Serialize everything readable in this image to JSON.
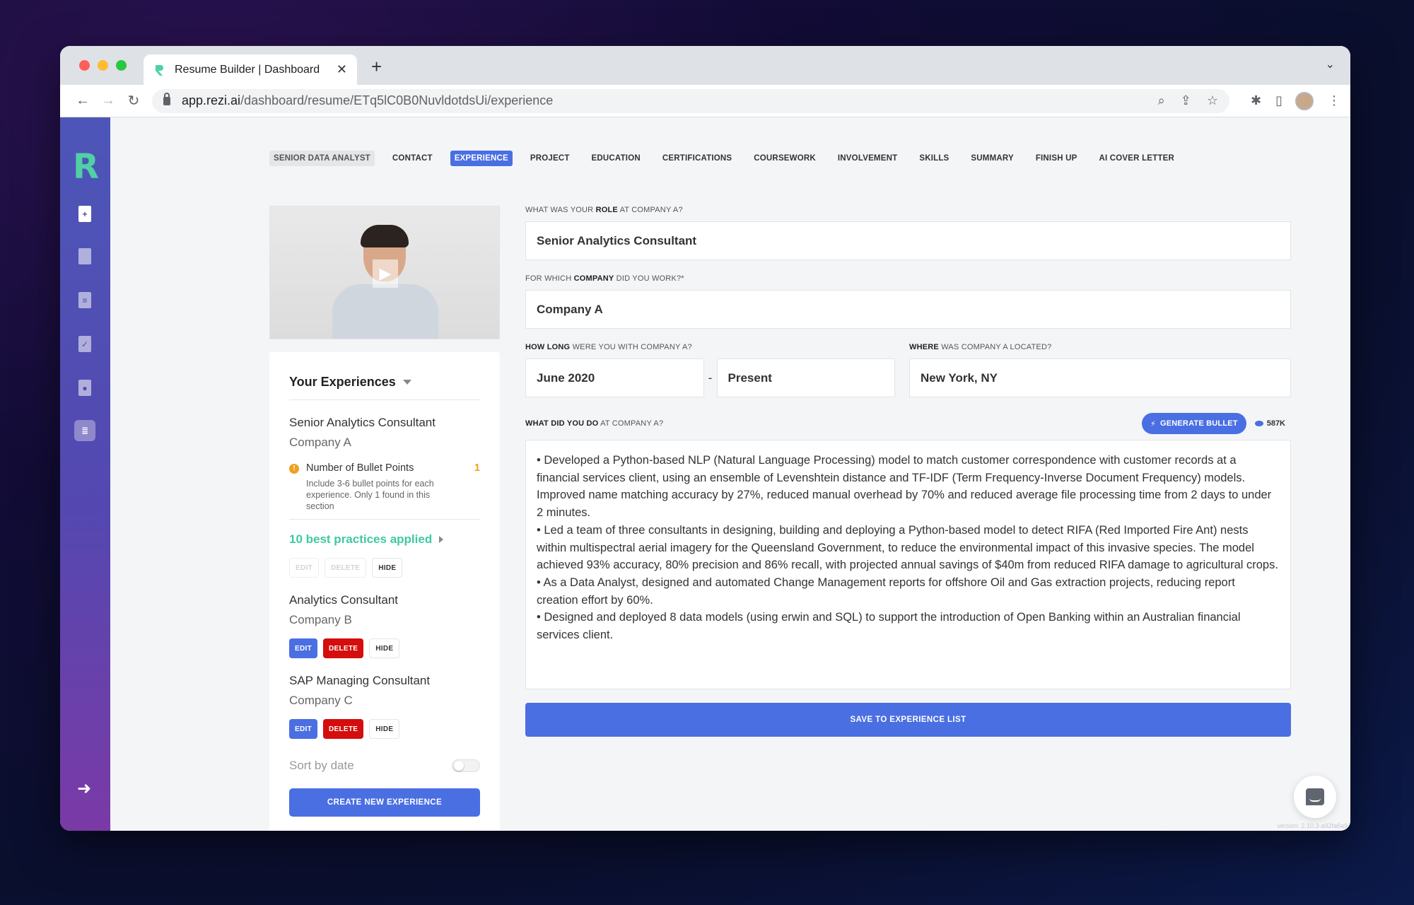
{
  "browser": {
    "tab_title": "Resume Builder | Dashboard",
    "url_domain": "app.rezi.ai",
    "url_path": "/dashboard/resume/ETq5lC0B0NuvldotdsUi/experience"
  },
  "colors": {
    "accent": "#4a6fe3",
    "delete": "#d40d0d",
    "success": "#3ec9a0",
    "warning": "#f0a020"
  },
  "sidebar": {
    "logo": "R",
    "icons": [
      "new-document-icon",
      "document-icon",
      "document-lines-icon",
      "checklist-icon",
      "profile-document-icon",
      "stack-icon",
      "logout-icon"
    ]
  },
  "steps": [
    {
      "label": "SENIOR DATA ANALYST",
      "state": "first"
    },
    {
      "label": "CONTACT",
      "state": ""
    },
    {
      "label": "EXPERIENCE",
      "state": "active"
    },
    {
      "label": "PROJECT",
      "state": ""
    },
    {
      "label": "EDUCATION",
      "state": ""
    },
    {
      "label": "CERTIFICATIONS",
      "state": ""
    },
    {
      "label": "COURSEWORK",
      "state": ""
    },
    {
      "label": "INVOLVEMENT",
      "state": ""
    },
    {
      "label": "SKILLS",
      "state": ""
    },
    {
      "label": "SUMMARY",
      "state": ""
    },
    {
      "label": "FINISH UP",
      "state": ""
    },
    {
      "label": "AI COVER LETTER",
      "state": ""
    }
  ],
  "experiences_panel": {
    "title": "Your Experiences",
    "current": {
      "role": "Senior Analytics Consultant",
      "company": "Company A",
      "warning_title": "Number of Bullet Points",
      "warning_count": "1",
      "warning_desc": "Include 3-6 bullet points for each experience. Only 1 found in this section",
      "best_practices": "10 best practices applied"
    },
    "others": [
      {
        "role": "Analytics Consultant",
        "company": "Company B"
      },
      {
        "role": "SAP Managing Consultant",
        "company": "Company C"
      }
    ],
    "edit_label": "EDIT",
    "delete_label": "DELETE",
    "hide_label": "HIDE",
    "sort_label": "Sort by date",
    "sort_enabled": false,
    "create_label": "CREATE NEW EXPERIENCE"
  },
  "form": {
    "role_label_pre": "WHAT WAS YOUR ",
    "role_label_bold": "ROLE",
    "role_label_post": " AT COMPANY A?",
    "role_value": "Senior Analytics Consultant",
    "company_label_pre": "FOR WHICH ",
    "company_label_bold": "COMPANY",
    "company_label_post": " DID YOU WORK?*",
    "company_value": "Company A",
    "howlong_label_bold": "HOW LONG",
    "howlong_label_post": " WERE YOU WITH COMPANY A?",
    "start_date": "June 2020",
    "date_separator": "-",
    "end_date": "Present",
    "where_label_bold": "WHERE",
    "where_label_post": " WAS COMPANY A LOCATED?",
    "location": "New York, NY",
    "do_label_bold": "WHAT DID YOU DO",
    "do_label_post": " AT COMPANY A?",
    "generate_label": "GENERATE BULLET",
    "tokens": "587K",
    "bullets": [
      "• Developed a Python-based NLP (Natural Language Processing) model to match customer correspondence with customer records at a financial services client, using an ensemble of Levenshtein distance and TF-IDF (Term Frequency-Inverse Document Frequency) models. Improved name matching accuracy by 27%, reduced manual overhead by 70% and reduced average file processing time from 2 days to under 2 minutes.",
      "• Led a team of three consultants in designing, building and deploying a Python-based model to detect RIFA (Red Imported Fire Ant) nests within multispectral aerial imagery for the Queensland Government, to reduce the environmental impact of this invasive species. The model achieved 93% accuracy, 80% precision and 86% recall, with projected annual savings of $40m from reduced RIFA damage to agricultural crops.",
      "• As a Data Analyst, designed and automated Change Management reports for offshore Oil and Gas extraction projects, reducing report creation effort by 60%.",
      "• Designed and deployed 8 data models (using erwin and SQL) to support the introduction of Open Banking within an Australian financial services client."
    ],
    "save_label": "SAVE TO EXPERIENCE LIST"
  },
  "version": "version: 2.10.3-a92fa6a9"
}
